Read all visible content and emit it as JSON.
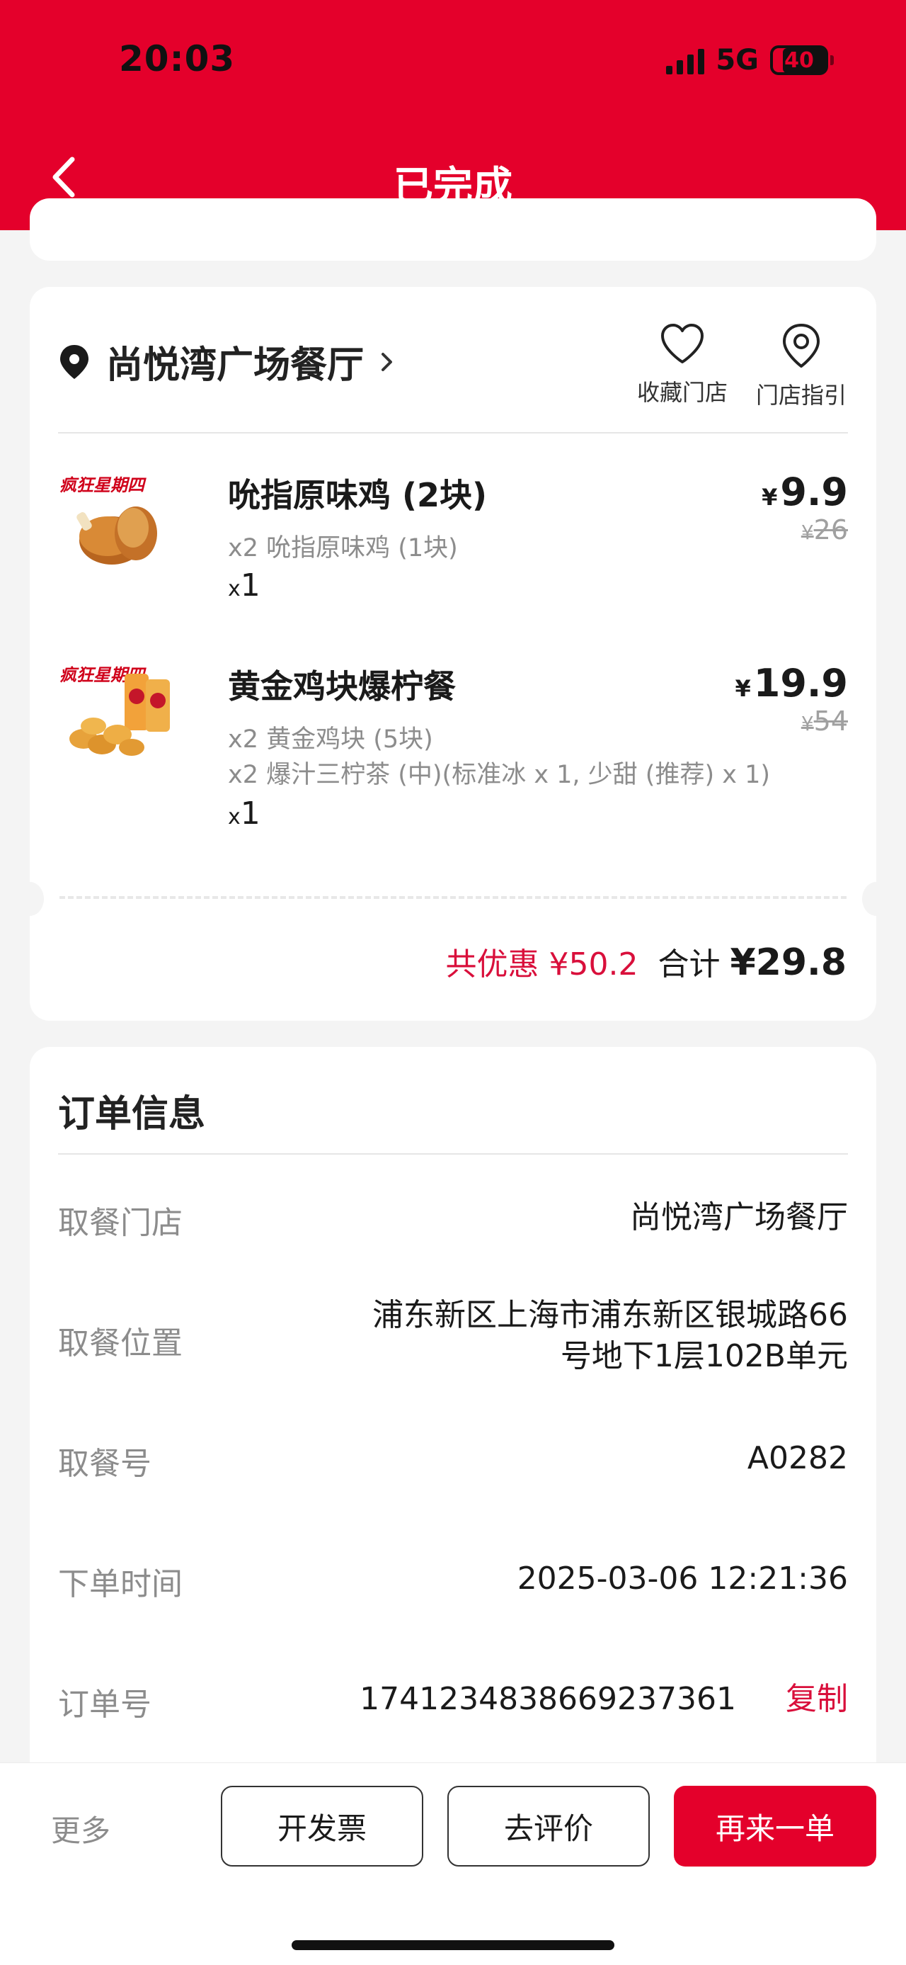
{
  "status_bar": {
    "time": "20:03",
    "network": "5G",
    "battery": "40",
    "battery_fraction": 0.4
  },
  "header": {
    "title": "已完成"
  },
  "store": {
    "name": "尚悦湾广场餐厅",
    "actions": [
      {
        "label": "收藏门店",
        "icon": "heart-icon"
      },
      {
        "label": "门店指引",
        "icon": "location-pin-icon"
      }
    ]
  },
  "items": [
    {
      "name": "吮指原味鸡 (2块)",
      "details": [
        "x2 吮指原味鸡 (1块)"
      ],
      "qty_prefix": "x",
      "qty": "1",
      "currency": "¥",
      "price": "9.9",
      "original_price": "26"
    },
    {
      "name": "黄金鸡块爆柠餐",
      "details": [
        "x2 黄金鸡块 (5块)",
        "x2 爆汁三柠茶 (中)(标准冰 x 1, 少甜 (推荐) x 1)"
      ],
      "qty_prefix": "x",
      "qty": "1",
      "currency": "¥",
      "price": "19.9",
      "original_price": "54"
    }
  ],
  "totals": {
    "discount_label": "共优惠",
    "discount_value": "¥50.2",
    "total_label": "合计",
    "total_value": "¥29.8"
  },
  "order_info": {
    "title": "订单信息",
    "rows": [
      {
        "label": "取餐门店",
        "value": "尚悦湾广场餐厅"
      },
      {
        "label": "取餐位置",
        "value_line1": "浦东新区上海市浦东新区银城路66",
        "value_line2": "号地下1层102B单元"
      },
      {
        "label": "取餐号",
        "value": "A0282"
      },
      {
        "label": "下单时间",
        "value": "2025-03-06 12:21:36"
      },
      {
        "label": "订单号",
        "value": "1741234838669237361",
        "action": "复制"
      }
    ]
  },
  "bottom_bar": {
    "more": "更多",
    "invoice": "开发票",
    "review": "去评价",
    "reorder": "再来一单"
  },
  "colors": {
    "brand_red": "#e4002b",
    "discount_red": "#d90f3b",
    "muted_text": "#8c8c8c"
  }
}
